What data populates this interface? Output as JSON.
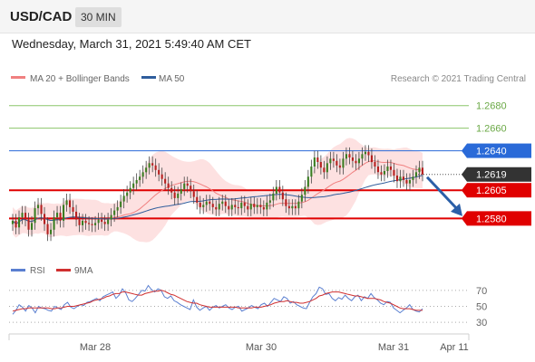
{
  "header": {
    "symbol": "USD/CAD",
    "timeframe": "30 MIN",
    "datetime": "Wednesday, March 31, 2021 5:49:40 AM CET"
  },
  "legend": {
    "ma20": "MA 20 + Bollinger Bands",
    "ma50": "MA 50",
    "credit": "Research © 2021 Trading Central",
    "rsi": "RSI",
    "ma9": "9MA"
  },
  "colors": {
    "ma20": "#f08080",
    "ma50": "#2f5d9c",
    "bands": "#fde1e1",
    "candle_up": "#3a7d22",
    "candle_down": "#b52020",
    "resistance_green": "#8cc56a",
    "level_blue": "#2a6ad8",
    "level_red": "#e00000",
    "current": "#333333",
    "arrow": "#2b5fa8",
    "rsi": "#5a7fd0",
    "rsi_ma9": "#d03030"
  },
  "chart_data": [
    {
      "type": "candlestick",
      "title": "USD/CAD",
      "ylim": [
        1.2545,
        1.2695
      ],
      "x_ticks": [
        "Mar 28",
        "Mar 30",
        "Mar 31",
        "Apr 11"
      ],
      "levels": [
        {
          "value": 1.268,
          "label": "1.2680",
          "kind": "resistance",
          "color": "#8cc56a"
        },
        {
          "value": 1.266,
          "label": "1.2660",
          "kind": "resistance",
          "color": "#8cc56a"
        },
        {
          "value": 1.264,
          "label": "1.2640",
          "kind": "pivot",
          "color": "#2a6ad8"
        },
        {
          "value": 1.2619,
          "label": "1.2619",
          "kind": "last",
          "color": "#333333"
        },
        {
          "value": 1.2605,
          "label": "1.2605",
          "kind": "support",
          "color": "#e00000"
        },
        {
          "value": 1.258,
          "label": "1.2580",
          "kind": "support",
          "color": "#e00000"
        }
      ],
      "closes": [
        1.2578,
        1.2572,
        1.2581,
        1.2585,
        1.2579,
        1.257,
        1.2576,
        1.2589,
        1.2592,
        1.2584,
        1.2575,
        1.2566,
        1.257,
        1.2581,
        1.2585,
        1.2578,
        1.2592,
        1.2596,
        1.259,
        1.2586,
        1.2579,
        1.2574,
        1.2578,
        1.2576,
        1.2575,
        1.2574,
        1.2576,
        1.2579,
        1.2577,
        1.2575,
        1.2579,
        1.2583,
        1.2587,
        1.259,
        1.2595,
        1.26,
        1.2603,
        1.2607,
        1.2611,
        1.2614,
        1.2617,
        1.2621,
        1.2625,
        1.2629,
        1.2627,
        1.2623,
        1.2619,
        1.2615,
        1.2611,
        1.2607,
        1.2603,
        1.2598,
        1.2602,
        1.2606,
        1.2611,
        1.2609,
        1.2604,
        1.2599,
        1.2594,
        1.259,
        1.2592,
        1.2595,
        1.2593,
        1.259,
        1.2588,
        1.2593,
        1.2595,
        1.2591,
        1.2588,
        1.2592,
        1.259,
        1.2589,
        1.2594,
        1.2591,
        1.2588,
        1.2593,
        1.259,
        1.2592,
        1.259,
        1.2588,
        1.2594,
        1.2596,
        1.2602,
        1.2608,
        1.2603,
        1.2597,
        1.2591,
        1.2589,
        1.2591,
        1.2589,
        1.2595,
        1.2601,
        1.2608,
        1.2617,
        1.2626,
        1.2634,
        1.263,
        1.2625,
        1.2621,
        1.2629,
        1.2633,
        1.2631,
        1.2627,
        1.2625,
        1.2633,
        1.2637,
        1.2634,
        1.2631,
        1.2629,
        1.2633,
        1.2637,
        1.2639,
        1.2636,
        1.263,
        1.2626,
        1.2621,
        1.2619,
        1.2622,
        1.2626,
        1.2623,
        1.2618,
        1.2613,
        1.2617,
        1.2614,
        1.2611,
        1.2614,
        1.2617,
        1.2621,
        1.2625,
        1.2619
      ],
      "series": [
        {
          "name": "MA 20 + Bollinger Bands"
        },
        {
          "name": "MA 50"
        }
      ]
    },
    {
      "type": "line",
      "title": "RSI",
      "ylim": [
        20,
        80
      ],
      "y_ticks": [
        70,
        50,
        30
      ],
      "series": [
        {
          "name": "RSI",
          "values": [
            40,
            45,
            52,
            49,
            44,
            51,
            48,
            42,
            50,
            48,
            47,
            45,
            44,
            50,
            48,
            46,
            52,
            55,
            49,
            47,
            50,
            52,
            51,
            55,
            56,
            58,
            60,
            57,
            62,
            64,
            66,
            68,
            60,
            64,
            72,
            67,
            58,
            56,
            60,
            65,
            70,
            69,
            76,
            71,
            68,
            72,
            70,
            62,
            60,
            63,
            57,
            55,
            52,
            50,
            48,
            46,
            58,
            49,
            45,
            48,
            50,
            45,
            49,
            51,
            48,
            50,
            52,
            48,
            46,
            49,
            50,
            44,
            46,
            48,
            51,
            49,
            47,
            52,
            54,
            50,
            55,
            60,
            58,
            56,
            62,
            60,
            54,
            56,
            52,
            50,
            48,
            47,
            55,
            62,
            66,
            74,
            72,
            65,
            66,
            60,
            57,
            61,
            59,
            64,
            60,
            57,
            62,
            64,
            57,
            62,
            60,
            66,
            61,
            58,
            54,
            52,
            56,
            55,
            48,
            45,
            42,
            45,
            48,
            52,
            46,
            44,
            43,
            47
          ]
        },
        {
          "name": "9MA",
          "values": [
            44,
            45,
            46,
            47,
            47,
            48,
            48,
            48,
            48,
            48,
            48,
            48,
            47,
            47,
            48,
            48,
            49,
            50,
            50,
            50,
            51,
            52,
            53,
            54,
            55,
            57,
            58,
            59,
            60,
            62,
            63,
            65,
            66,
            66,
            68,
            68,
            67,
            66,
            65,
            64,
            64,
            66,
            67,
            68,
            69,
            69,
            70,
            69,
            67,
            65,
            64,
            62,
            60,
            58,
            56,
            55,
            54,
            54,
            52,
            51,
            50,
            49,
            49,
            49,
            49,
            49,
            49,
            49,
            49,
            49,
            48,
            48,
            48,
            48,
            48,
            49,
            49,
            49,
            50,
            51,
            52,
            54,
            55,
            56,
            56,
            57,
            56,
            55,
            55,
            54,
            54,
            55,
            56,
            58,
            60,
            63,
            64,
            66,
            67,
            68,
            68,
            68,
            67,
            66,
            65,
            64,
            63,
            63,
            62,
            61,
            60,
            60,
            60,
            59,
            58,
            56,
            55,
            54,
            52,
            50,
            48,
            47,
            47,
            47,
            46,
            45,
            45,
            45
          ]
        }
      ]
    }
  ]
}
